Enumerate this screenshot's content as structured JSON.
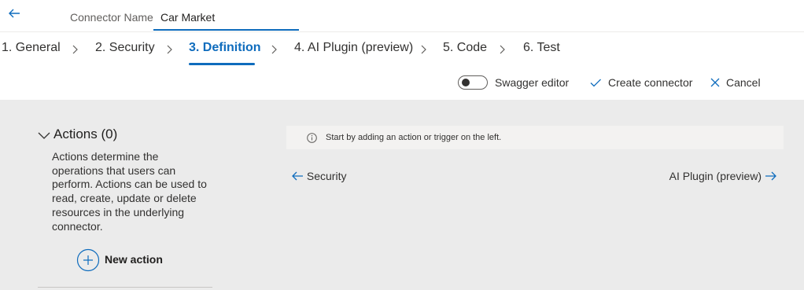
{
  "header": {
    "connector_label": "Connector Name",
    "connector_value": "Car Market"
  },
  "steps": [
    {
      "label": "1. General",
      "active": false
    },
    {
      "label": "2. Security",
      "active": false
    },
    {
      "label": "3. Definition",
      "active": true
    },
    {
      "label": "4. AI Plugin (preview)",
      "active": false
    },
    {
      "label": "5. Code",
      "active": false
    },
    {
      "label": "6. Test",
      "active": false
    }
  ],
  "commands": {
    "swagger_toggle_on": false,
    "swagger_label": "Swagger editor",
    "create_label": "Create connector",
    "cancel_label": "Cancel"
  },
  "actions": {
    "title": "Actions (0)",
    "description": "Actions determine the operations that users can perform. Actions can be used to read, create, update or delete resources in the underlying connector.",
    "new_action_label": "New action"
  },
  "info": {
    "message": "Start by adding an action or trigger on the left."
  },
  "nav": {
    "prev_label": "Security",
    "next_label": "AI Plugin (preview)"
  },
  "colors": {
    "accent": "#0f6cbd",
    "content_bg": "#ebebeb"
  },
  "icons": [
    "back-arrow-icon",
    "chevron-right-icon",
    "checkmark-icon",
    "close-icon",
    "chevron-down-icon",
    "plus-circle-icon",
    "info-icon",
    "arrow-left-icon",
    "arrow-right-icon"
  ]
}
